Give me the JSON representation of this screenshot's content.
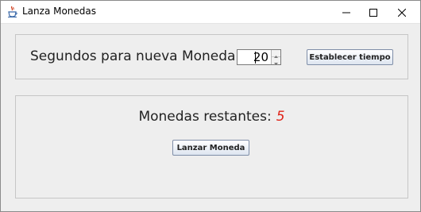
{
  "window": {
    "title": "Lanza Monedas",
    "icon": "java-cup-icon",
    "controls": [
      "minimize-icon",
      "maximize-icon",
      "close-icon"
    ]
  },
  "config_panel": {
    "seconds_label": "Segundos para nueva Moneda:",
    "seconds_value": "20",
    "set_time_button": "Establecer tiempo"
  },
  "coin_panel": {
    "remaining_label": "Monedas restantes:",
    "remaining_count": "5",
    "toss_button": "Lanzar Moneda"
  },
  "colors": {
    "count_color": "#e0251b",
    "panel_border": "#c6c6c6",
    "background": "#eeeeee"
  }
}
